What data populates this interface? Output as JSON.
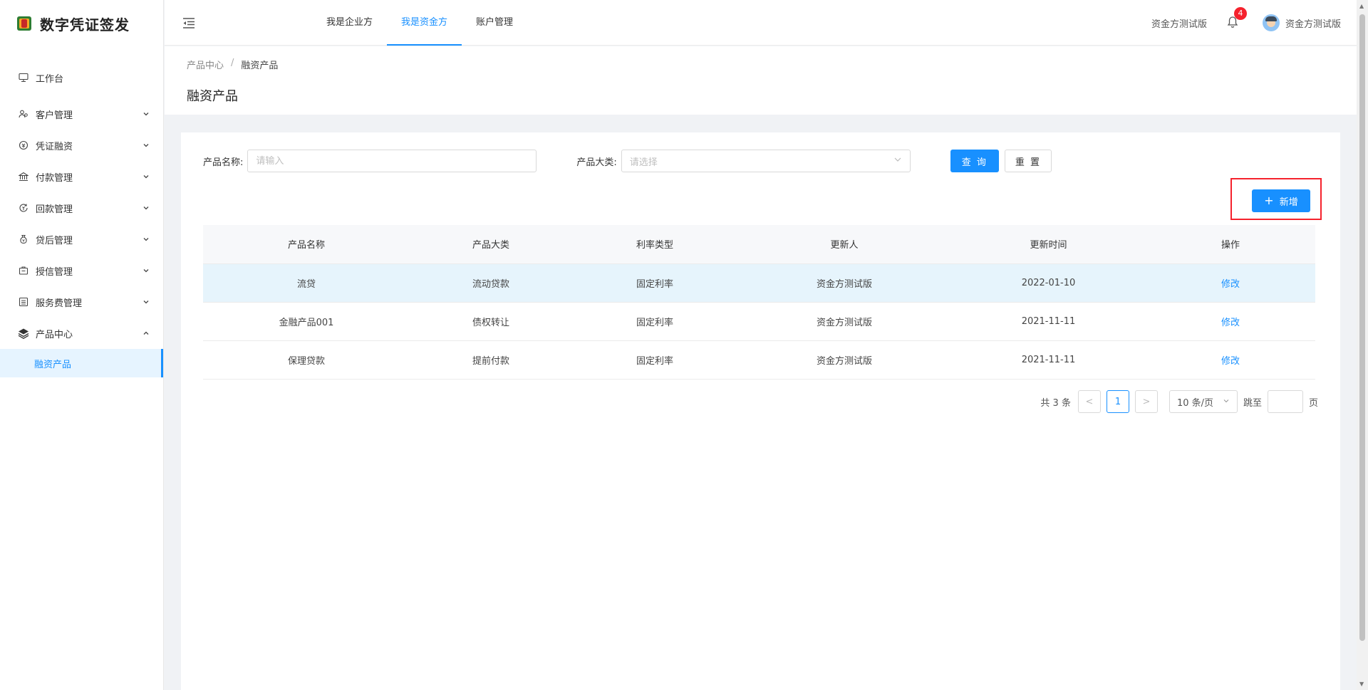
{
  "app": {
    "title": "数字凭证签发"
  },
  "sidebar": {
    "items": [
      {
        "label": "工作台",
        "icon": "monitor-icon",
        "expandable": false
      },
      {
        "label": "客户管理",
        "icon": "users-icon",
        "expandable": true,
        "expanded": false
      },
      {
        "label": "凭证融资",
        "icon": "coin-icon",
        "expandable": true,
        "expanded": false
      },
      {
        "label": "付款管理",
        "icon": "bank-icon",
        "expandable": true,
        "expanded": false
      },
      {
        "label": "回款管理",
        "icon": "return-icon",
        "expandable": true,
        "expanded": false
      },
      {
        "label": "贷后管理",
        "icon": "money-bag-icon",
        "expandable": true,
        "expanded": false
      },
      {
        "label": "授信管理",
        "icon": "credit-icon",
        "expandable": true,
        "expanded": false
      },
      {
        "label": "服务费管理",
        "icon": "list-icon",
        "expandable": true,
        "expanded": false
      },
      {
        "label": "产品中心",
        "icon": "layers-icon",
        "expandable": true,
        "expanded": true
      }
    ],
    "active_sub": {
      "label": "融资产品"
    }
  },
  "header": {
    "tabs": [
      {
        "label": "我是企业方",
        "active": false
      },
      {
        "label": "我是资金方",
        "active": true
      },
      {
        "label": "账户管理",
        "active": false
      }
    ],
    "org_label": "资金方测试版",
    "notification_count": "4",
    "user_name": "资金方测试版"
  },
  "breadcrumb": {
    "parent": "产品中心",
    "separator": "/",
    "current": "融资产品"
  },
  "page_title": "融资产品",
  "filters": {
    "name_label": "产品名称:",
    "name_placeholder": "请输入",
    "category_label": "产品大类:",
    "category_placeholder": "请选择",
    "search_label": "查 询",
    "reset_label": "重 置"
  },
  "add_button": {
    "label": "新增",
    "plus": "+"
  },
  "table": {
    "columns": [
      "产品名称",
      "产品大类",
      "利率类型",
      "更新人",
      "更新时间",
      "操作"
    ],
    "rows": [
      {
        "name": "流贷",
        "category": "流动贷款",
        "rate_type": "固定利率",
        "updater": "资金方测试版",
        "updated": "2022-01-10",
        "action": "修改"
      },
      {
        "name": "金融产品001",
        "category": "债权转让",
        "rate_type": "固定利率",
        "updater": "资金方测试版",
        "updated": "2021-11-11",
        "action": "修改"
      },
      {
        "name": "保理贷款",
        "category": "提前付款",
        "rate_type": "固定利率",
        "updater": "资金方测试版",
        "updated": "2021-11-11",
        "action": "修改"
      }
    ]
  },
  "pagination": {
    "total": "共 3 条",
    "prev": "<",
    "current_page": "1",
    "next": ">",
    "page_size": "10 条/页",
    "jump_label": "跳至",
    "page_suffix": "页"
  },
  "colors": {
    "primary": "#1890ff",
    "highlight_row": "#e6f4fc",
    "annotation_box": "#f5222d"
  }
}
